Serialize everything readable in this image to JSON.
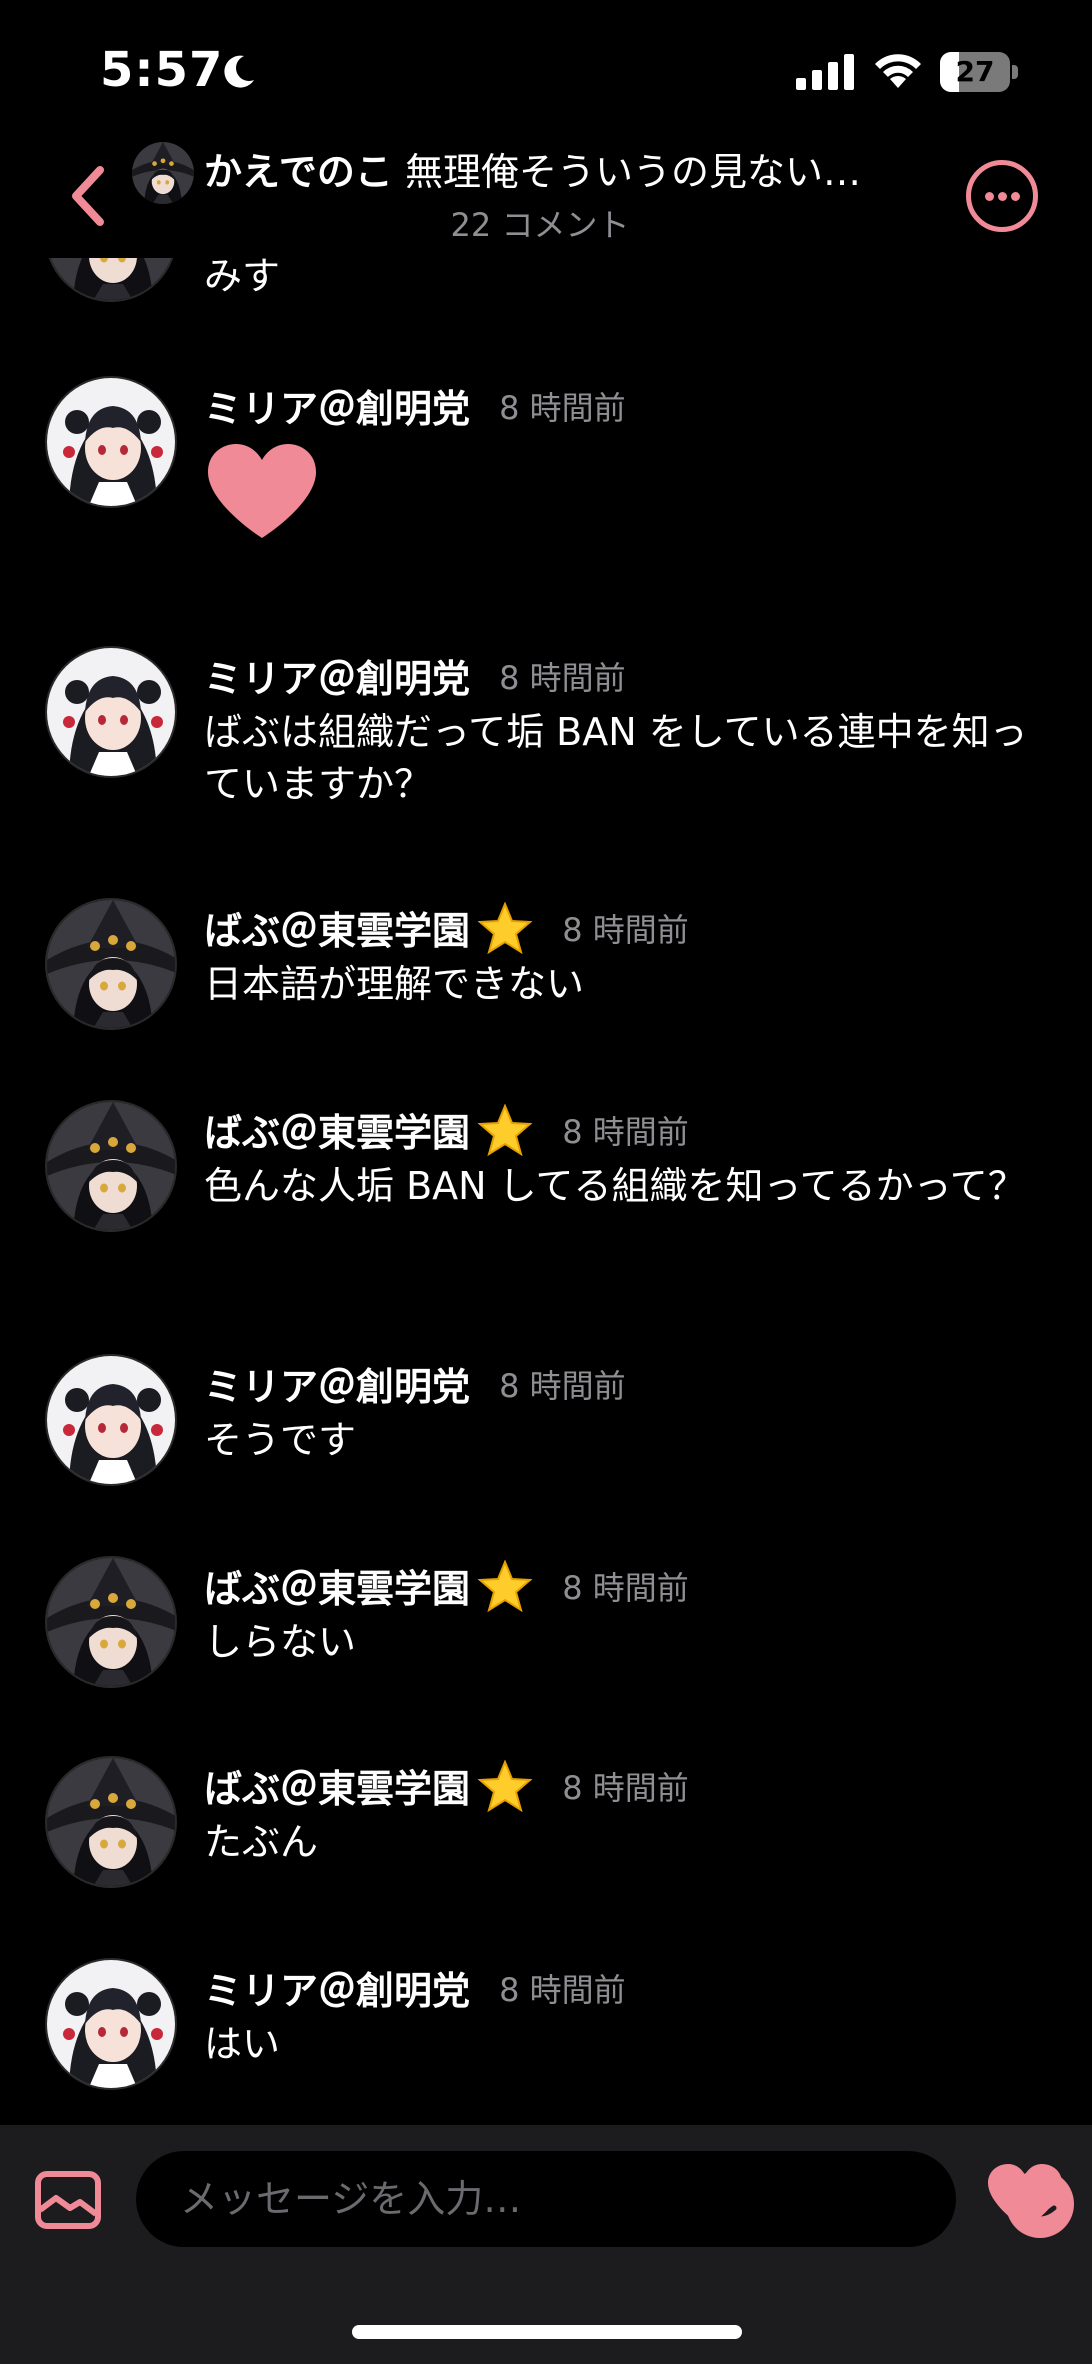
{
  "status_bar": {
    "time": "5:57",
    "battery": "27",
    "battery_level": 0.27
  },
  "header": {
    "author": "かえでのこ",
    "post_title": "無理俺そういうの見ない…",
    "comment_count": "22 コメント"
  },
  "colors": {
    "accent": "#f08a96",
    "muted": "#8e8e93",
    "bar": "#1c1c1e"
  },
  "partial_message": {
    "text": "みす"
  },
  "messages": [
    {
      "name": "ミリア＠創明党",
      "time": "8 時間前",
      "text": ""
    },
    {
      "name": "ミリア＠創明党",
      "time": "8 時間前",
      "text": "ばぶは組織だって垢 BAN をしている連中を知っていますか？"
    },
    {
      "name": "ばぶ＠東雲学園",
      "time": "8 時間前",
      "text": "日本語が理解できない"
    },
    {
      "name": "ばぶ＠東雲学園",
      "time": "8 時間前",
      "text": "色んな人垢 BAN してる組織を知ってるかって？"
    },
    {
      "name": "ミリア＠創明党",
      "time": "8 時間前",
      "text": "そうです"
    },
    {
      "name": "ばぶ＠東雲学園",
      "time": "8 時間前",
      "text": "しらない"
    },
    {
      "name": "ばぶ＠東雲学園",
      "time": "8 時間前",
      "text": "たぶん"
    },
    {
      "name": "ミリア＠創明党",
      "time": "8 時間前",
      "text": "はい"
    }
  ],
  "composer": {
    "placeholder": "メッセージを入力…"
  }
}
